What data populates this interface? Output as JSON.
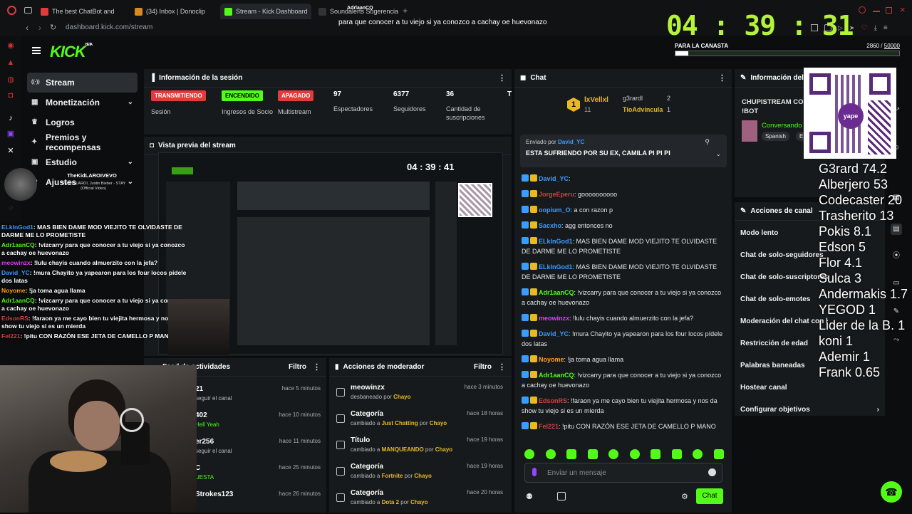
{
  "browser": {
    "tabs": [
      {
        "label": "The best ChatBot and",
        "color": "#e23b3b"
      },
      {
        "label": "(34) Inbox | Donoclip",
        "color": "#d88a21"
      },
      {
        "label": "Stream - Kick Dashboard",
        "color": "#53fc18"
      },
      {
        "label": "Soundalerts Sugerencias",
        "color": "#333"
      }
    ],
    "tab_overlay": "AdrlaanCQ",
    "url": "dashboard.kick.com/stream"
  },
  "caption": "para que conocer a tu viejo si ya conozco a cachay oe huevonazo",
  "clock": "04 : 39 : 31",
  "goal": {
    "label": "PARA LA CANASTA",
    "current": "2860",
    "target": "50000",
    "progress": 0.057
  },
  "kick_logo": "KICK",
  "kick_beta": "BETA",
  "nav": [
    {
      "label": "Stream",
      "icon": "stream-icon",
      "active": true
    },
    {
      "label": "Monetización",
      "icon": "money-icon",
      "chevron": true
    },
    {
      "label": "Logros",
      "icon": "trophy-icon"
    },
    {
      "label": "Premios y recompensas",
      "icon": "gift-icon"
    },
    {
      "label": "Estudio",
      "icon": "studio-icon",
      "chevron": true
    },
    {
      "label": "Ajustes",
      "icon": "gear-icon",
      "chevron": true
    }
  ],
  "music": {
    "title": "TheKidLAROIVEVO",
    "subtitle": "The Kid LAROI, Justin Bieber - STAY (Official Video)"
  },
  "session": {
    "title": "Información de la sesión",
    "stats": [
      {
        "badge": "TRANSMITIENDO",
        "badge_color": "#e23b3b",
        "label": "Sesión"
      },
      {
        "badge": "ENCENDIDO",
        "badge_color": "#53fc18",
        "label": "Ingresos de Socio"
      },
      {
        "badge": "APAGADO",
        "badge_color": "#e23b3b",
        "label": "Multistream"
      },
      {
        "value": "97",
        "label": "Espectadores"
      },
      {
        "value": "6377",
        "label": "Seguidores"
      },
      {
        "value": "36",
        "label": "Cantidad de suscripciones"
      },
      {
        "value": "T",
        "label": ""
      }
    ]
  },
  "preview": {
    "title": "Vista previa del stream",
    "clock": "04 : 39 : 41"
  },
  "activity": {
    "title": "Feed de actividades",
    "filter": "Filtro",
    "items": [
      {
        "t": "21",
        "d": "seguir el canal",
        "time": "hace 5 minutos"
      },
      {
        "t": "402",
        "d": "Hell Yeah",
        "time": "hace 10 minutos"
      },
      {
        "t": "er256",
        "d": "seguir el canal",
        "time": "hace 11 minutos"
      },
      {
        "t": "C",
        "d": "UESTA",
        "time": "hace 25 minutos"
      },
      {
        "t": "Strokes123",
        "d": "",
        "time": "hace 26 minutos"
      }
    ]
  },
  "mod_actions": {
    "title": "Acciones de moderador",
    "filter": "Filtro",
    "items": [
      {
        "t": "meowinzx",
        "d1": "desbaneado por ",
        "h": "Chayo",
        "time": "hace 3 minutos"
      },
      {
        "t": "Categoría",
        "d1": "cambiado a ",
        "h": "Just Chatting",
        "d2": " por ",
        "h2": "Chayo",
        "time": "hace 18 horas"
      },
      {
        "t": "Título",
        "d1": "cambiado a ",
        "h": "MANQUEANDO",
        "d2": " por ",
        "h2": "Chayo",
        "time": "hace 19 horas"
      },
      {
        "t": "Categoría",
        "d1": "cambiado a ",
        "h": "Fortnite",
        "d2": " por ",
        "h2": "Chayo",
        "time": "hace 19 horas"
      },
      {
        "t": "Categoría",
        "d1": "cambiado a ",
        "h": "Dota 2",
        "d2": " por ",
        "h2": "Chayo",
        "time": "hace 20 horas"
      }
    ]
  },
  "chat": {
    "title": "Chat",
    "top": [
      {
        "rank": "1",
        "name": "lxVellxl",
        "count": "11"
      },
      {
        "name": "g3rardl",
        "count": "2"
      },
      {
        "name": "TioAdvincula",
        "count": "1"
      }
    ],
    "pinned": {
      "by_label": "Enviado por",
      "by": "David_YC",
      "text": "ESTA SUFRIENDO POR SU EX, CAMILA PI PI PI"
    },
    "messages": [
      {
        "user": "David_YC",
        "color": "#3b9cff",
        "text": ""
      },
      {
        "user": "JorgeEperu",
        "color": "#c44",
        "text": "goooooooooo"
      },
      {
        "user": "oopium_O",
        "color": "#3b9cff",
        "text": "a con razon p"
      },
      {
        "user": "Sacxho",
        "color": "#3b9cff",
        "text": "agg entonces no"
      },
      {
        "user": "ELkInGod1",
        "color": "#3b9cff",
        "text": "MAS BIEN DAME MOD VIEJITO TE OLVIDASTE DE DARME ME LO PROMETISTE"
      },
      {
        "user": "ELkInGod1",
        "color": "#3b9cff",
        "text": "MAS BIEN DAME MOD VIEJITO TE OLVIDASTE DE DARME ME LO PROMETISTE"
      },
      {
        "user": "Adr1aanCQ",
        "color": "#53fc18",
        "text": "!vizcarry para que conocer a tu viejo si ya conozco a cachay oe huevonazo"
      },
      {
        "user": "meowinzx",
        "color": "#e040fb",
        "text": "!lulu chayis cuando almuerzito con la jefa?"
      },
      {
        "user": "David_YC",
        "color": "#3b9cff",
        "text": "!mura Chayito ya yapearon para los four locos pídele dos latas"
      },
      {
        "user": "Noyome",
        "color": "#ff9f1a",
        "text": "!ja toma agua llama"
      },
      {
        "user": "Adr1aanCQ",
        "color": "#53fc18",
        "text": "!vizcarry para que conocer a tu viejo si ya conozco a cachay oe huevonazo"
      },
      {
        "user": "EdsonRS",
        "color": "#c44",
        "text": "!faraon ya me cayo bien tu viejita hermosa y nos da show tu viejo si es un mierda"
      },
      {
        "user": "Fel221",
        "color": "#c44",
        "text": "!pitu CON RAZÓN ESE JETA DE CAMELLO P MANO"
      }
    ],
    "placeholder": "Enviar un mensaje",
    "send": "Chat"
  },
  "stream_info": {
    "title": "Información del s",
    "stream_title": "CHUPISTREAM CO !BOT",
    "category": "Conversando",
    "lang": "Spanish",
    "tag2": "E"
  },
  "channel_actions": {
    "title": "Acciones de canal",
    "items": [
      "Modo lento",
      "Chat de solo-seguidores",
      "Chat de solo-suscriptores",
      "Chat de solo-emotes",
      "Moderación del chat con l",
      "Restricción de edad",
      "Palabras baneadas",
      "Hostear canal",
      "Configurar objetivos"
    ]
  },
  "qr_label": "yape",
  "ranking": [
    "G3rard 74.2",
    "Alberjero 53",
    "Codecaster 20",
    "Trasherito 13",
    "Pokis 8.1",
    "Edson 5",
    "Flor 4.1",
    "Sulca 3",
    "Andermakis 1.7",
    "YEGOD 1",
    "Lider de la B. 1",
    "koni 1",
    "Ademir 1",
    "Frank 0.65"
  ],
  "overlay_chat": [
    {
      "user": "ELkInGod1",
      "text": "MAS BIEN DAME MOD VIEJITO TE OLVIDASTE DE DARME ME LO PROMETISTE",
      "color": "#3b9cff"
    },
    {
      "user": "Adr1aanCQ",
      "text": "!vizcarry para que conocer a tu viejo si ya conozco a cachay oe huevonazo",
      "color": "#53fc18"
    },
    {
      "user": "meowinzx",
      "text": "!lulu chayis cuando almuerzito con la jefa?",
      "color": "#e040fb"
    },
    {
      "user": "David_YC",
      "text": "!mura Chayito ya yapearon para los four locos pídele dos latas",
      "color": "#3b9cff"
    },
    {
      "user": "Noyome",
      "text": "!ja toma agua llama",
      "color": "#ff9f1a"
    },
    {
      "user": "Adr1aanCQ",
      "text": "!vizcarry para que conocer a tu viejo si ya conozco a cachay oe huevonazo",
      "color": "#53fc18"
    },
    {
      "user": "EdsonRS",
      "text": "!faraon ya me cayo bien tu viejita hermosa y nos da show tu viejo si es un mierda",
      "color": "#c44"
    },
    {
      "user": "Fel221",
      "text": "!pitu CON RAZÓN ESE JETA DE CAMELLO P MANO",
      "color": "#c44"
    }
  ]
}
